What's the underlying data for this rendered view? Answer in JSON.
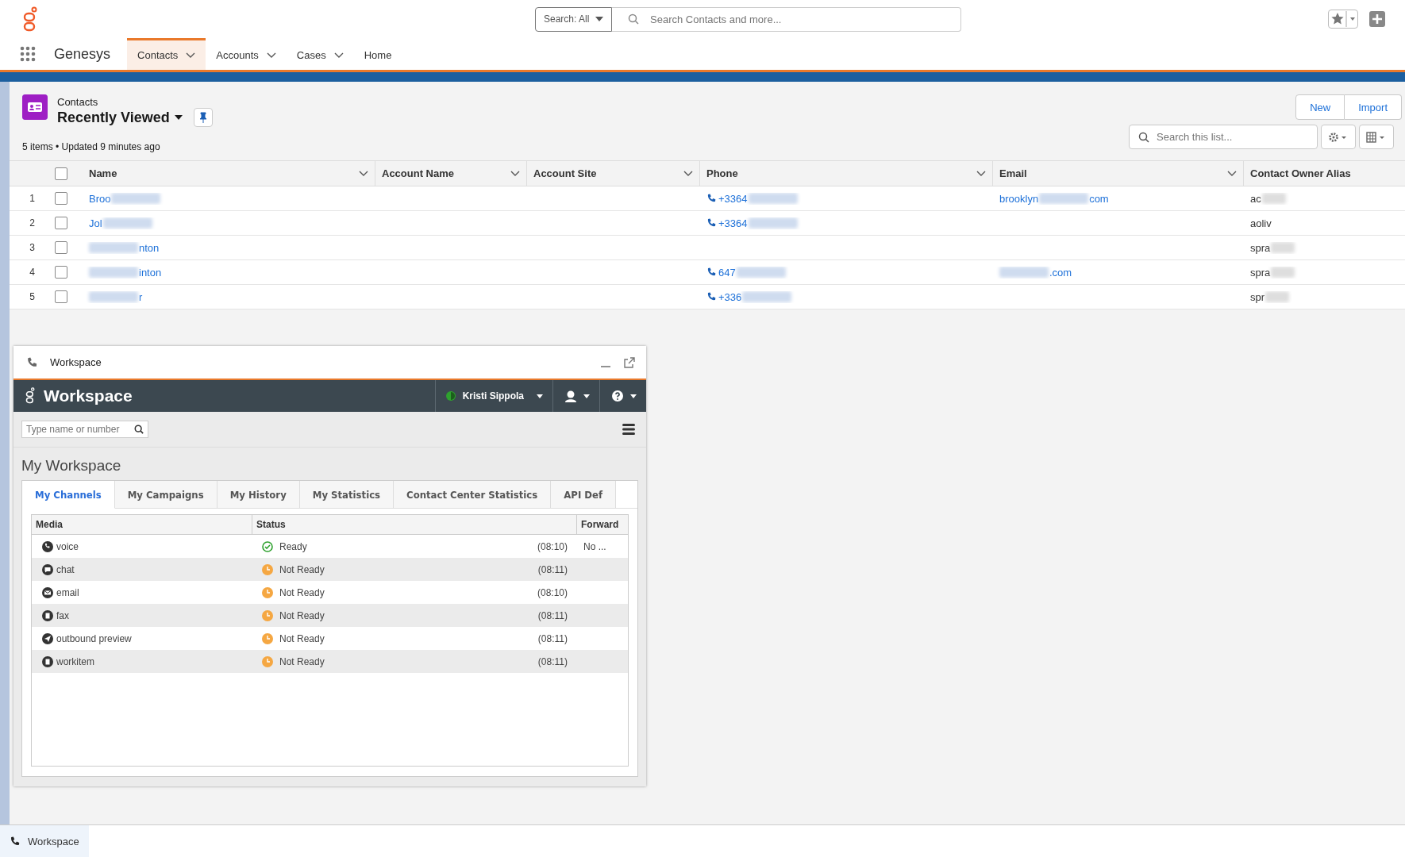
{
  "header": {
    "search_scope": "Search: All",
    "search_placeholder": "Search Contacts and more..."
  },
  "nav": {
    "app_name": "Genesys",
    "tabs": [
      {
        "label": "Contacts",
        "selected": true,
        "menu": true
      },
      {
        "label": "Accounts",
        "selected": false,
        "menu": true
      },
      {
        "label": "Cases",
        "selected": false,
        "menu": true
      },
      {
        "label": "Home",
        "selected": false,
        "menu": false
      }
    ]
  },
  "list_view": {
    "object": "Contacts",
    "title": "Recently Viewed",
    "summary": "5 items • Updated 9 minutes ago",
    "buttons": [
      "New",
      "Import"
    ],
    "select_all_checked": false,
    "search_placeholder": "Search this list...",
    "columns": [
      {
        "label": "Name",
        "menu": true
      },
      {
        "label": "Account Name",
        "menu": true
      },
      {
        "label": "Account Site",
        "menu": true
      },
      {
        "label": "Phone",
        "menu": true
      },
      {
        "label": "Email",
        "menu": true
      },
      {
        "label": "Contact Owner Alias",
        "menu": false
      }
    ],
    "rows": [
      {
        "number": "1",
        "checked": false,
        "name": [
          {
            "kind": "text",
            "text": "Broo"
          },
          {
            "kind": "redacted"
          }
        ],
        "phone": [
          {
            "kind": "text",
            "text": "+3364"
          },
          {
            "kind": "redacted"
          }
        ],
        "email": [
          {
            "kind": "text",
            "text": "brooklyn"
          },
          {
            "kind": "redacted"
          },
          {
            "kind": "text",
            "text": "com"
          }
        ],
        "alias": [
          {
            "kind": "text",
            "text": "ac"
          },
          {
            "kind": "redacted"
          }
        ]
      },
      {
        "number": "2",
        "checked": false,
        "name": [
          {
            "kind": "text",
            "text": "Jol"
          },
          {
            "kind": "redacted"
          }
        ],
        "phone": [
          {
            "kind": "text",
            "text": "+3364"
          },
          {
            "kind": "redacted"
          }
        ],
        "alias": [
          {
            "kind": "text",
            "text": "aoliv"
          }
        ]
      },
      {
        "number": "3",
        "checked": false,
        "name": [
          {
            "kind": "redacted"
          },
          {
            "kind": "text",
            "text": "nton"
          }
        ],
        "alias": [
          {
            "kind": "text",
            "text": "spra"
          },
          {
            "kind": "redacted"
          }
        ]
      },
      {
        "number": "4",
        "checked": false,
        "name": [
          {
            "kind": "redacted"
          },
          {
            "kind": "text",
            "text": "inton"
          }
        ],
        "phone": [
          {
            "kind": "text",
            "text": "647"
          },
          {
            "kind": "redacted"
          }
        ],
        "email": [
          {
            "kind": "redacted"
          },
          {
            "kind": "text",
            "text": ".com"
          }
        ],
        "alias": [
          {
            "kind": "text",
            "text": "spra"
          },
          {
            "kind": "redacted"
          }
        ]
      },
      {
        "number": "5",
        "checked": false,
        "name": [
          {
            "kind": "redacted"
          },
          {
            "kind": "text",
            "text": "r"
          }
        ],
        "phone": [
          {
            "kind": "text",
            "text": "+336"
          },
          {
            "kind": "redacted"
          }
        ],
        "alias": [
          {
            "kind": "text",
            "text": "spr"
          },
          {
            "kind": "redacted"
          }
        ]
      }
    ]
  },
  "workspace": {
    "window_title": "Workspace",
    "brand": "Workspace",
    "agent": {
      "name": "Kristi Sippola",
      "ready": true
    },
    "search_placeholder": "Type name or number",
    "heading": "My Workspace",
    "tabs": [
      {
        "label": "My Channels",
        "selected": true
      },
      {
        "label": "My Campaigns",
        "selected": false
      },
      {
        "label": "My History",
        "selected": false
      },
      {
        "label": "My Statistics",
        "selected": false
      },
      {
        "label": "Contact Center Statistics",
        "selected": false
      },
      {
        "label": "API Def",
        "selected": false
      }
    ],
    "columns": [
      "Media",
      "Status",
      "Forward"
    ],
    "channels": [
      {
        "kind": "voice",
        "media": "voice",
        "ready": true,
        "status": "Ready",
        "time": "(08:10)",
        "forward": "No ..."
      },
      {
        "kind": "chat",
        "media": "chat",
        "ready": false,
        "status": "Not Ready",
        "time": "(08:11)"
      },
      {
        "kind": "email",
        "media": "email",
        "ready": false,
        "status": "Not Ready",
        "time": "(08:10)"
      },
      {
        "kind": "fax",
        "media": "fax",
        "ready": false,
        "status": "Not Ready",
        "time": "(08:11)"
      },
      {
        "kind": "outbound",
        "media": "outbound preview",
        "ready": false,
        "status": "Not Ready",
        "time": "(08:11)"
      },
      {
        "kind": "workitem",
        "media": "workitem",
        "ready": false,
        "status": "Not Ready",
        "time": "(08:11)"
      }
    ]
  },
  "footer": {
    "tab": "Workspace"
  }
}
